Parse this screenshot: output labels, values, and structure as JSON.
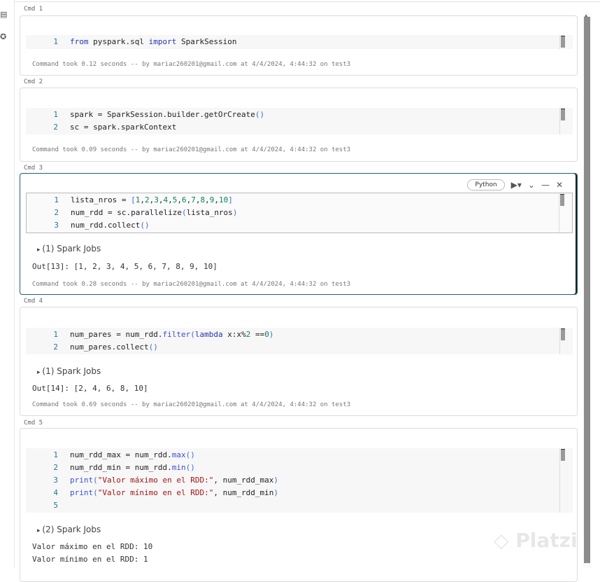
{
  "cells": [
    {
      "label": "Cmd 1",
      "lines": [
        [
          [
            "from",
            "kw"
          ],
          [
            " pyspark.sql ",
            ""
          ],
          [
            "import",
            "kw"
          ],
          [
            " SparkSession",
            ""
          ]
        ]
      ],
      "took": "Command took 0.12 seconds -- by mariac260201@gmail.com at 4/4/2024, 4:44:32 on test3"
    },
    {
      "label": "Cmd 2",
      "lines": [
        [
          [
            "spark = SparkSession.builder.getOrCreate",
            ""
          ],
          [
            "()",
            "par"
          ]
        ],
        [
          [
            "sc = spark.sparkContext",
            ""
          ]
        ]
      ],
      "took": "Command took 0.09 seconds -- by mariac260201@gmail.com at 4/4/2024, 4:44:32 on test3"
    },
    {
      "label": "Cmd 3",
      "lines": [
        [
          [
            "lista_nros = ",
            ""
          ],
          [
            "[",
            "par"
          ],
          [
            "1",
            "num"
          ],
          [
            ",",
            ""
          ],
          [
            "2",
            "num"
          ],
          [
            ",",
            ""
          ],
          [
            "3",
            "num"
          ],
          [
            ",",
            ""
          ],
          [
            "4",
            "num"
          ],
          [
            ",",
            ""
          ],
          [
            "5",
            "num"
          ],
          [
            ",",
            ""
          ],
          [
            "6",
            "num"
          ],
          [
            ",",
            ""
          ],
          [
            "7",
            "num"
          ],
          [
            ",",
            ""
          ],
          [
            "8",
            "num"
          ],
          [
            ",",
            ""
          ],
          [
            "9",
            "num"
          ],
          [
            ",",
            ""
          ],
          [
            "10",
            "num"
          ],
          [
            "]",
            "par"
          ]
        ],
        [
          [
            "num_rdd = sc.parallelize",
            ""
          ],
          [
            "(",
            "par"
          ],
          [
            "lista_nros",
            ""
          ],
          [
            ")",
            "par"
          ]
        ],
        [
          [
            "num_rdd.collect",
            ""
          ],
          [
            "()",
            "par"
          ]
        ]
      ],
      "jobs": "(1) Spark Jobs",
      "output": "Out[13]: [1, 2, 3, 4, 5, 6, 7, 8, 9, 10]",
      "took": "Command took 0.28 seconds -- by mariac260201@gmail.com at 4/4/2024, 4:44:32 on test3",
      "language": "Python"
    },
    {
      "label": "Cmd 4",
      "lines": [
        [
          [
            "num_pares = num_rdd.",
            ""
          ],
          [
            "filter",
            "fn"
          ],
          [
            "(",
            "par"
          ],
          [
            "lambda",
            "kw"
          ],
          [
            " x:x%",
            ""
          ],
          [
            "2",
            "num"
          ],
          [
            " ==",
            ""
          ],
          [
            "0",
            "num"
          ],
          [
            ")",
            "par"
          ]
        ],
        [
          [
            "num_pares.collect",
            ""
          ],
          [
            "()",
            "par"
          ]
        ]
      ],
      "jobs": "(1) Spark Jobs",
      "output": "Out[14]: [2, 4, 6, 8, 10]",
      "took": "Command took 0.69 seconds -- by mariac260201@gmail.com at 4/4/2024, 4:44:32 on test3"
    },
    {
      "label": "Cmd 5",
      "lines": [
        [
          [
            "num_rdd_max = num_rdd.",
            ""
          ],
          [
            "max",
            "fn"
          ],
          [
            "()",
            "par"
          ]
        ],
        [
          [
            "num_rdd_min = num_rdd.",
            ""
          ],
          [
            "min",
            "fn"
          ],
          [
            "()",
            "par"
          ]
        ],
        [
          [
            "print",
            "fn"
          ],
          [
            "(",
            "par"
          ],
          [
            "\"Valor máximo en el RDD:\"",
            "str"
          ],
          [
            ", num_rdd_max",
            ""
          ],
          [
            ")",
            "par"
          ]
        ],
        [
          [
            "print",
            "fn"
          ],
          [
            "(",
            "par"
          ],
          [
            "\"Valor mínimo en el RDD:\"",
            "str"
          ],
          [
            ", num_rdd_min",
            ""
          ],
          [
            ")",
            "par"
          ]
        ],
        [
          [
            "",
            ""
          ]
        ]
      ],
      "jobs": "(2) Spark Jobs",
      "output": "Valor máximo en el RDD: 10\nValor mínimo en el RDD: 1"
    }
  ],
  "watermark": "Platzi",
  "icons": {
    "toc": "list-icon",
    "assistant": "sparkle-icon",
    "run": "play-icon",
    "expand": "chevron-down-icon",
    "minimize": "minus-icon",
    "close": "close-icon"
  }
}
